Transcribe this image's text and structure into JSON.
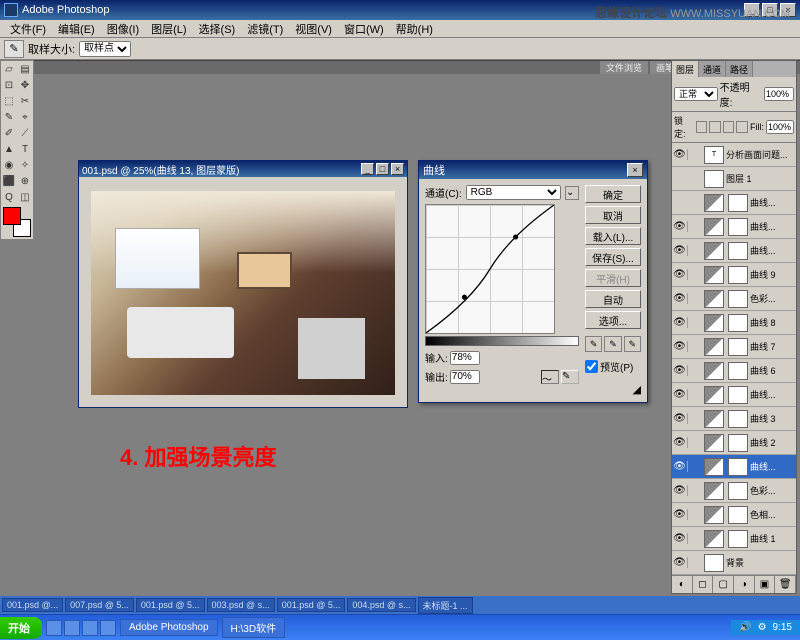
{
  "app": {
    "title": "Adobe Photoshop"
  },
  "watermark": {
    "text1": "思缘设计论坛",
    "text2": "WWW.MISSYUAN.COM"
  },
  "menu": [
    "文件(F)",
    "编辑(E)",
    "图像(I)",
    "图层(L)",
    "选择(S)",
    "滤镜(T)",
    "视图(V)",
    "窗口(W)",
    "帮助(H)"
  ],
  "options": {
    "label": "取样大小:",
    "value": "取样点"
  },
  "top_tabs": [
    "文件浏览",
    "画笔"
  ],
  "doc": {
    "title": "001.psd @ 25%(曲线 13, 图层蒙版)"
  },
  "annotation": "4. 加强场景亮度",
  "curves": {
    "title": "曲线",
    "channel_label": "通道(C):",
    "channel": "RGB",
    "input_label": "输入:",
    "input": "78%",
    "output_label": "输出:",
    "output": "70%",
    "buttons": {
      "ok": "确定",
      "cancel": "取消",
      "load": "载入(L)...",
      "save": "保存(S)...",
      "smooth": "平滑(H)",
      "auto": "自动",
      "options": "选项..."
    },
    "preview": "预览(P)"
  },
  "layers": {
    "tabs": [
      "图层",
      "通道",
      "路径"
    ],
    "mode": "正常",
    "opacity_label": "不透明度:",
    "opacity": "100%",
    "lock_label": "锁定:",
    "fill_label": "Fill:",
    "fill": "100%",
    "items": [
      {
        "eye": "👁",
        "type": "text",
        "name": "分析画面问题...",
        "thumb": "T"
      },
      {
        "eye": "",
        "type": "img",
        "name": "图层 1"
      },
      {
        "eye": "",
        "type": "adj",
        "name": "曲线..."
      },
      {
        "eye": "👁",
        "type": "adj",
        "name": "曲线..."
      },
      {
        "eye": "👁",
        "type": "adj",
        "name": "曲线..."
      },
      {
        "eye": "👁",
        "type": "adj",
        "name": "曲线 9"
      },
      {
        "eye": "👁",
        "type": "adj",
        "name": "色彩..."
      },
      {
        "eye": "👁",
        "type": "adj",
        "name": "曲线 8"
      },
      {
        "eye": "👁",
        "type": "adj",
        "name": "曲线 7"
      },
      {
        "eye": "👁",
        "type": "adj",
        "name": "曲线 6"
      },
      {
        "eye": "👁",
        "type": "adj",
        "name": "曲线..."
      },
      {
        "eye": "👁",
        "type": "adj",
        "name": "曲线 3"
      },
      {
        "eye": "👁",
        "type": "adj",
        "name": "曲线 2"
      },
      {
        "eye": "👁",
        "type": "adj",
        "name": "曲线...",
        "sel": true
      },
      {
        "eye": "👁",
        "type": "adj",
        "name": "色彩..."
      },
      {
        "eye": "👁",
        "type": "adj",
        "name": "色相..."
      },
      {
        "eye": "👁",
        "type": "adj",
        "name": "曲线 1"
      },
      {
        "eye": "👁",
        "type": "img",
        "name": "背景"
      }
    ]
  },
  "taskbar_docs": [
    "001.psd @...",
    "007.psd @ 5...",
    "001.psd @ 5...",
    "003.psd @ s...",
    "001.psd @ 5...",
    "004.psd @ s...",
    "未标题-1 ..."
  ],
  "taskbar": {
    "start": "开始",
    "items": [
      "Adobe Photoshop",
      "H:\\3D软件"
    ],
    "time": "9:15"
  }
}
